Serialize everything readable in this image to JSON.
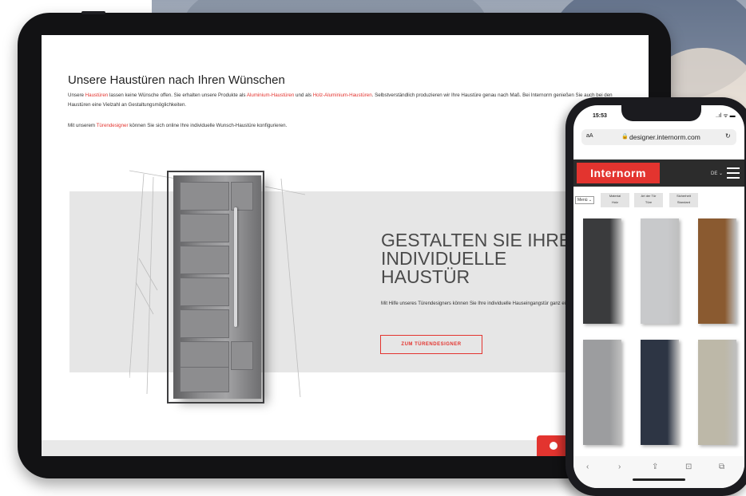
{
  "tablet": {
    "heading": "Unsere Haustüren nach Ihren Wünschen",
    "para1_pre": "Unsere ",
    "para1_link1": "Haustüren",
    "para1_mid": " lassen keine Wünsche offen. Sie erhalten unsere Produkte als ",
    "para1_link2": "Aluminium-Haustüren",
    "para1_mid2": " und als ",
    "para1_link3": "Holz-Aluminium-Haustüren",
    "para1_post": ". Selbstverständlich produzieren wir Ihre Haustüre genau nach Maß. Bei Internorm genießen Sie auch bei den Haustüren eine Vielzahl an Gestaltungsmöglichkeiten.",
    "para2_pre": "Mit unserem ",
    "para2_link": "Türendesigner",
    "para2_post": " können Sie sich online Ihre individuelle Wunsch-Haustüre konfigurieren.",
    "banner_title": "GESTALTEN SIE IHRE\nINDIVIDUELLE\nHAUSTÜR",
    "banner_text": "Mit Hilfe unseres Türendesigners können Sie Ihre individuelle Hauseingangstür ganz einfach online gestalten.",
    "cta_label": "ZUM TÜRENDESIGNER"
  },
  "phone": {
    "time": "15:53",
    "status": "..ıl ᯤ ▬",
    "url_aa": "aA",
    "url_lock": "🔒",
    "url_domain": "designer.internorm.com",
    "url_reload": "↻",
    "brand": "Internorm",
    "lang": "DE ⌄",
    "filter_menu": "Menü ⌄",
    "filters": [
      {
        "label": "Material",
        "value": "Holz"
      },
      {
        "label": "Art der Tür",
        "value": "Türe"
      },
      {
        "label": "Sicherheit",
        "value": "Standard"
      }
    ],
    "toolbar": [
      "‹",
      "›",
      "⇪",
      "⊡",
      "⧉"
    ]
  },
  "colors": {
    "accent": "#e3342f",
    "dark": "#2c2c2c"
  },
  "door_colors": [
    "#3a3b3d",
    "#c8c9cb",
    "#8a5a30",
    "#9c9d9f",
    "#2d3544",
    "#bdb8a8"
  ]
}
